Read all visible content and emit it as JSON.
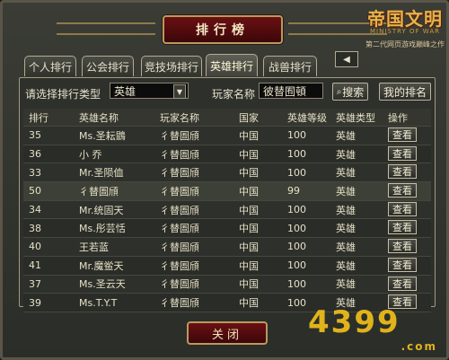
{
  "window": {
    "title": "排行榜",
    "logo": {
      "main": "帝国文明",
      "english": "MINISTRY OF WAR",
      "sub": "第二代网页游戏巅峰之作"
    }
  },
  "tabs": [
    {
      "label": "个人排行",
      "active": false
    },
    {
      "label": "公会排行",
      "active": false
    },
    {
      "label": "竞技场排行",
      "active": false
    },
    {
      "label": "英雄排行",
      "active": true
    },
    {
      "label": "战兽排行",
      "active": false
    }
  ],
  "nav": {
    "prev_icon": "arrow-left-icon"
  },
  "filter": {
    "type_label": "请选择排行类型",
    "type_value": "英雄",
    "player_label": "玩家名称",
    "player_value": "彼替囿頓",
    "search_label": "搜索",
    "my_rank_label": "我的排名"
  },
  "table": {
    "headers": [
      "排行",
      "英雄名称",
      "玩家名称",
      "国家",
      "英雄等级",
      "英雄类型",
      "操作"
    ],
    "rows": [
      [
        "35",
        "Ms.圣耘鵾",
        "彳替圄頎",
        "中国",
        "100",
        "英雄",
        "查看"
      ],
      [
        "36",
        "小  乔",
        "彳替圄頎",
        "中国",
        "100",
        "英雄",
        "查看"
      ],
      [
        "33",
        "Mr.圣陨侐",
        "彳替圄頎",
        "中国",
        "100",
        "英雄",
        "查看"
      ],
      [
        "50",
        "彳替圄頎",
        "彳替圄頎",
        "中国",
        "99",
        "英雄",
        "查看"
      ],
      [
        "34",
        "Mr.统固天",
        "彳替圄頎",
        "中国",
        "100",
        "英雄",
        "查看"
      ],
      [
        "38",
        "Ms.彤芸恬",
        "彳替圄頎",
        "中国",
        "100",
        "英雄",
        "查看"
      ],
      [
        "40",
        "王若蓝",
        "彳替圄頎",
        "中国",
        "100",
        "英雄",
        "查看"
      ],
      [
        "41",
        "Mr.魔鲎天",
        "彳替圄頎",
        "中国",
        "100",
        "英雄",
        "查看"
      ],
      [
        "37",
        "Ms.圣云天",
        "彳替圄頎",
        "中国",
        "100",
        "英雄",
        "查看"
      ],
      [
        "39",
        "Ms.T.Y.T",
        "彳替圄頎",
        "中国",
        "100",
        "英雄",
        "查看"
      ]
    ],
    "highlighted_row": 3
  },
  "footer": {
    "close_label": "关闭",
    "watermark": "4399",
    "watermark_domain": ".com"
  },
  "colors": {
    "accent": "#6a1012",
    "gold": "#e3b54b",
    "panel": "#2e302b"
  }
}
